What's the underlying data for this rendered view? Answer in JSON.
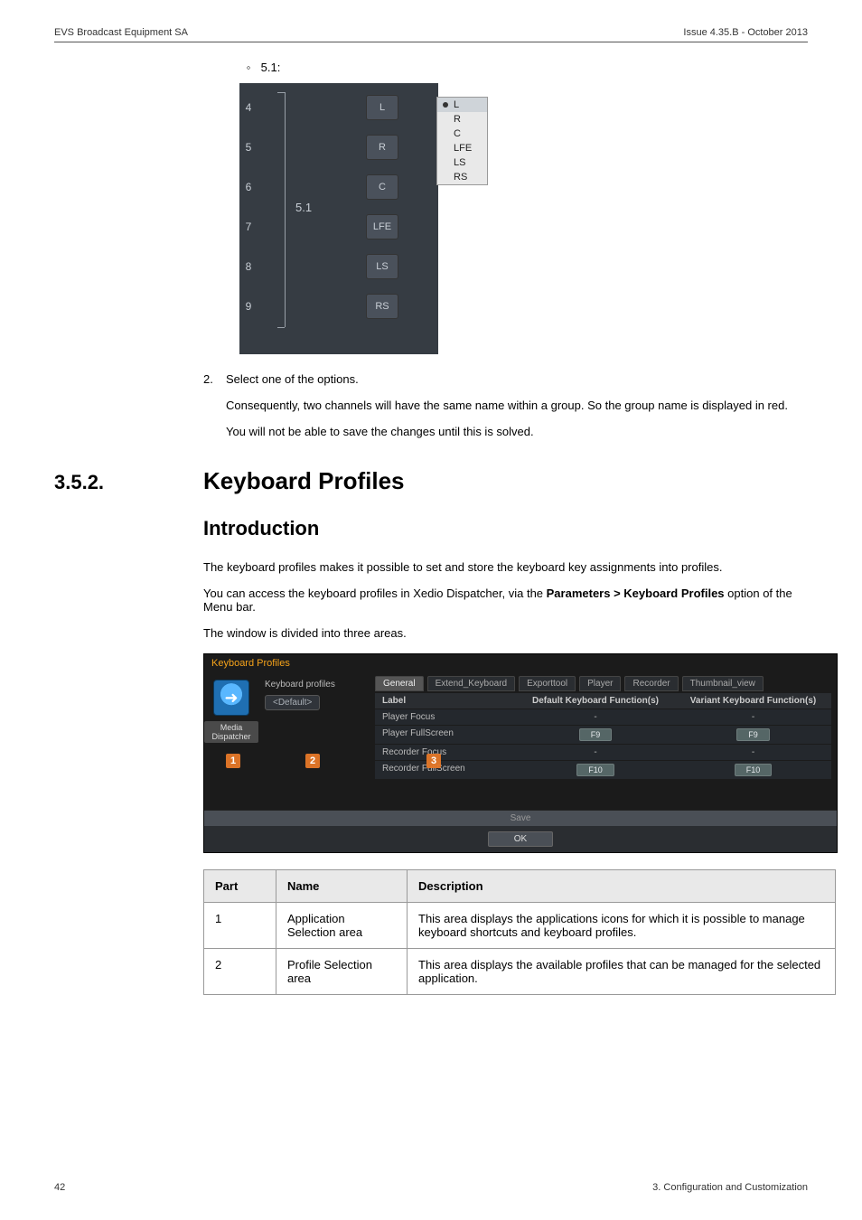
{
  "header": {
    "left": "EVS Broadcast Equipment SA",
    "right": "Issue 4.35.B - October 2013"
  },
  "bullet_51_label": "5.1:",
  "audio_diagram": {
    "group_label": "5.1",
    "rows": [
      {
        "num": "4",
        "text": "L"
      },
      {
        "num": "5",
        "text": "R"
      },
      {
        "num": "6",
        "text": "C"
      },
      {
        "num": "7",
        "text": "LFE"
      },
      {
        "num": "8",
        "text": "LS"
      },
      {
        "num": "9",
        "text": "RS"
      }
    ],
    "dropdown": {
      "selected": "L",
      "options": [
        "L",
        "R",
        "C",
        "LFE",
        "LS",
        "RS"
      ]
    }
  },
  "step2": {
    "num": "2.",
    "text": "Select one of the options.",
    "p1": "Consequently, two channels will have the same name within a group. So the group name is displayed in red.",
    "p2": "You will not be able to save the changes until this is solved."
  },
  "section": {
    "num": "3.5.2.",
    "title": "Keyboard Profiles"
  },
  "intro_heading": "Introduction",
  "intro_p1": "The keyboard profiles makes it possible to set and store the keyboard key assignments into profiles.",
  "intro_p2_a": "You can access the keyboard profiles in Xedio Dispatcher, via the ",
  "intro_p2_b": "Parameters > Keyboard Profiles",
  "intro_p2_c": " option of the Menu bar.",
  "intro_p3": "The window is divided into three areas.",
  "window": {
    "title": "Keyboard Profiles",
    "col1_label": "Media Dispatcher",
    "col2_title": "Keyboard profiles",
    "col2_chip": "<Default>",
    "tabs": [
      "General",
      "Extend_Keyboard",
      "Exporttool",
      "Player",
      "Recorder",
      "Thumbnail_view"
    ],
    "grid_headers": {
      "a": "Label",
      "b": "Default Keyboard Function(s)",
      "c": "Variant Keyboard Function(s)"
    },
    "grid_rows": [
      {
        "a": "Player Focus",
        "b": "-",
        "c": "-"
      },
      {
        "a": "Player FullScreen",
        "b": "F9",
        "c": "F9"
      },
      {
        "a": "Recorder Focus",
        "b": "-",
        "c": "-"
      },
      {
        "a": "Recorder FullScreen",
        "b": "F10",
        "c": "F10"
      }
    ],
    "overlays": {
      "n1": "1",
      "n2": "2",
      "n3": "3"
    },
    "save": "Save",
    "ok": "OK"
  },
  "table": {
    "headers": {
      "part": "Part",
      "name": "Name",
      "desc": "Description"
    },
    "rows": [
      {
        "part": "1",
        "name": "Application Selection area",
        "desc": "This area displays the applications icons for which it is possible to manage keyboard shortcuts and keyboard profiles."
      },
      {
        "part": "2",
        "name": "Profile Selection area",
        "desc": "This area displays the available profiles that can be managed for the selected application."
      }
    ]
  },
  "footer": {
    "page": "42",
    "section": "3. Configuration and Customization"
  }
}
